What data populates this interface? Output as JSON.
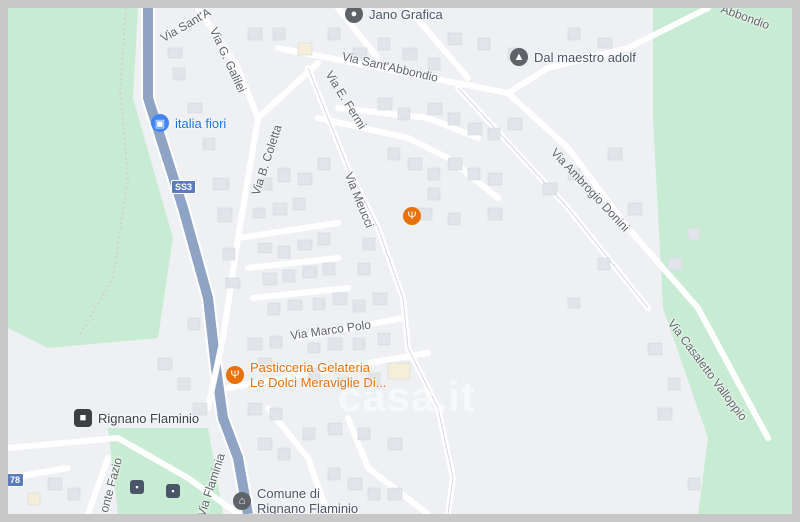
{
  "map": {
    "streets": {
      "via_sant_a_top": "Via Sant'A",
      "via_g_galilei": "Via G. Galilei",
      "via_sant_abbondio": "Via Sant'Abbondio",
      "via_abbondio_right": "Abbondio",
      "via_e_fermi": "Via E. Fermi",
      "via_b_coletta": "Via B. Coletta",
      "via_meucci": "Via Meucci",
      "via_ambrogio_donini": "Via Ambrogio Donini",
      "via_marco_polo": "Via Marco Polo",
      "via_casaletto_valloppio": "Via Casaletto Valloppio",
      "via_flaminia": "Via Flaminia",
      "monte_fazio": "onte Fazio"
    },
    "road_shield": "SS3",
    "edge_shield": "78",
    "pois": {
      "jano_grafica": "Jano Grafica",
      "dal_maestro": "Dal maestro adolf",
      "italia_fiori": "italia fiori",
      "pasticceria_line1": "Pasticceria Gelateria",
      "pasticceria_line2": "Le Dolci Meraviglie Di...",
      "rignano_station": "Rignano Flaminio",
      "comune_line1": "Comune di",
      "comune_line2": "Rignano Flaminio"
    },
    "watermark": "casa.it",
    "colors": {
      "park": "#c8ecd3",
      "road": "#ffffff",
      "highway": "#8fa4c4",
      "rail": "#c4c4c4",
      "orange": "#e8710a"
    }
  }
}
